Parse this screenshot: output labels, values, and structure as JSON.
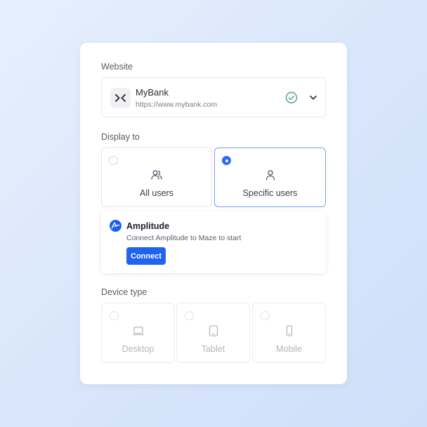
{
  "website": {
    "label": "Website",
    "site_name": "MyBank",
    "site_url": "https://www.mybank.com",
    "logo_icon": "mybank-logo-icon",
    "status_icon": "verified-check-icon",
    "dropdown_icon": "chevron-down-icon"
  },
  "display_to": {
    "label": "Display to",
    "options": [
      {
        "label": "All users",
        "icon": "users-icon",
        "selected": false
      },
      {
        "label": "Specific users",
        "icon": "user-icon",
        "selected": true
      }
    ]
  },
  "amplitude": {
    "title": "Amplitude",
    "description": "Connect Amplitude to Maze to start",
    "button_label": "Connect",
    "logo_icon": "amplitude-logo-icon"
  },
  "device_type": {
    "label": "Device type",
    "options": [
      {
        "label": "Desktop",
        "icon": "desktop-icon",
        "enabled": false
      },
      {
        "label": "Tablet",
        "icon": "tablet-icon",
        "enabled": false
      },
      {
        "label": "Mobile",
        "icon": "mobile-icon",
        "enabled": false
      }
    ]
  },
  "colors": {
    "accent": "#1f63f0",
    "selected_border": "#7b9ef0",
    "verified_green": "#4aa37f",
    "amplitude_blue": "#1e61f0"
  }
}
